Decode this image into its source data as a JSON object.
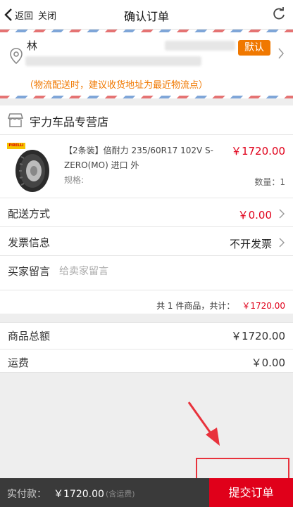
{
  "nav": {
    "back_label": "返回",
    "close_label": "关闭",
    "title": "确认订单"
  },
  "address": {
    "name": "林",
    "default_badge": "默认",
    "note": "（物流配送时，建议收货地址为最近物流点）"
  },
  "store": {
    "name": "宇力车品专营店",
    "product": {
      "title": "【2条装】倍耐力 235/60R17 102V S-ZERO(MO) 进口 外",
      "price": "￥1720.00",
      "spec_label": "规格:",
      "quantity": "数量：1",
      "thumb_brand": "PIRELLI"
    },
    "delivery": {
      "label": "配送方式",
      "value": "￥0.00"
    },
    "invoice": {
      "label": "发票信息",
      "value": "不开发票"
    },
    "message": {
      "label": "买家留言",
      "placeholder": "给卖家留言"
    },
    "total_text": "共 1 件商品，共计：",
    "total_amount": "￥1720.00"
  },
  "summary": {
    "goods_total_label": "商品总额",
    "goods_total_value": "￥1720.00",
    "shipping_label": "运费",
    "shipping_value": "￥0.00"
  },
  "bottom": {
    "pay_label": "实付款：",
    "pay_amount": "￥1720.00",
    "pay_note": "(含运费)",
    "submit_label": "提交订单"
  },
  "colors": {
    "accent": "#e0001a",
    "warning": "#f07800",
    "bar": "#3a3a3a"
  },
  "icons": [
    "chevron-left-icon",
    "refresh-icon",
    "location-pin-icon",
    "store-icon",
    "chevron-right-icon"
  ]
}
